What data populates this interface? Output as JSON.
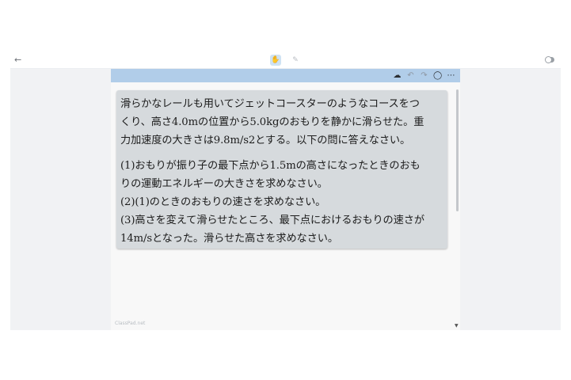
{
  "toolbar": {
    "back_icon": "arrow-left-icon",
    "hand_icon": "hand-icon",
    "pen_icon": "pen-icon",
    "toggle_icon": "toggle-icon"
  },
  "canvas_header": {
    "icons": [
      "cloud-sync-icon",
      "undo-icon",
      "redo-icon",
      "circle-icon",
      "more-icon"
    ]
  },
  "problem": {
    "intro": [
      "滑らかなレールも用いてジェットコースターのようなコースをつ",
      "くり、高さ4.0mの位置から5.0kgのおもりを静かに滑らせた。重",
      "力加速度の大きさは9.8m/s2とする。以下の問に答えなさい。"
    ],
    "questions": [
      "(1)おもりが振り子の最下点から1.5mの高さになったときのおも",
      "りの運動エネルギーの大きさを求めなさい。",
      "(2)(1)のときのおもりの速さを求めなさい。",
      "(3)高さを変えて滑らせたところ、最下点におけるおもりの速さが",
      "14m/sとなった。滑らせた高さを求めなさい。"
    ]
  },
  "watermark": "ClassPad.net"
}
